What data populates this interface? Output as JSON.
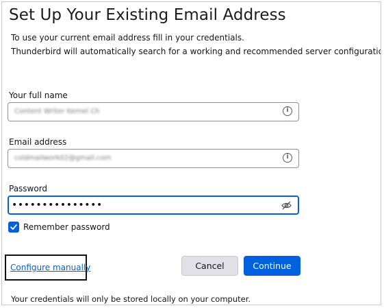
{
  "header": {
    "title": "Set Up Your Existing Email Address",
    "line1": "To use your current email address fill in your credentials.",
    "line2": "Thunderbird will automatically search for a working and recommended server configuration."
  },
  "form": {
    "name_label": "Your full name",
    "name_value": "Content Writer Kernel Ch",
    "email_label": "Email address",
    "email_value": "coldmailwork02@gmail.com",
    "password_label": "Password",
    "password_value": "•••••••••••••••",
    "remember_label": "Remember password",
    "remember_checked": true
  },
  "actions": {
    "configure_manually": "Configure manually",
    "cancel": "Cancel",
    "continue": "Continue"
  },
  "footer": {
    "note": "Your credentials will only be stored locally on your computer."
  },
  "colors": {
    "accent": "#0061e0",
    "button_secondary": "#e0e0e6"
  },
  "icons": {
    "field_info": "info-icon",
    "password_toggle": "eye-slash-icon",
    "checkbox": "checkmark-icon"
  }
}
